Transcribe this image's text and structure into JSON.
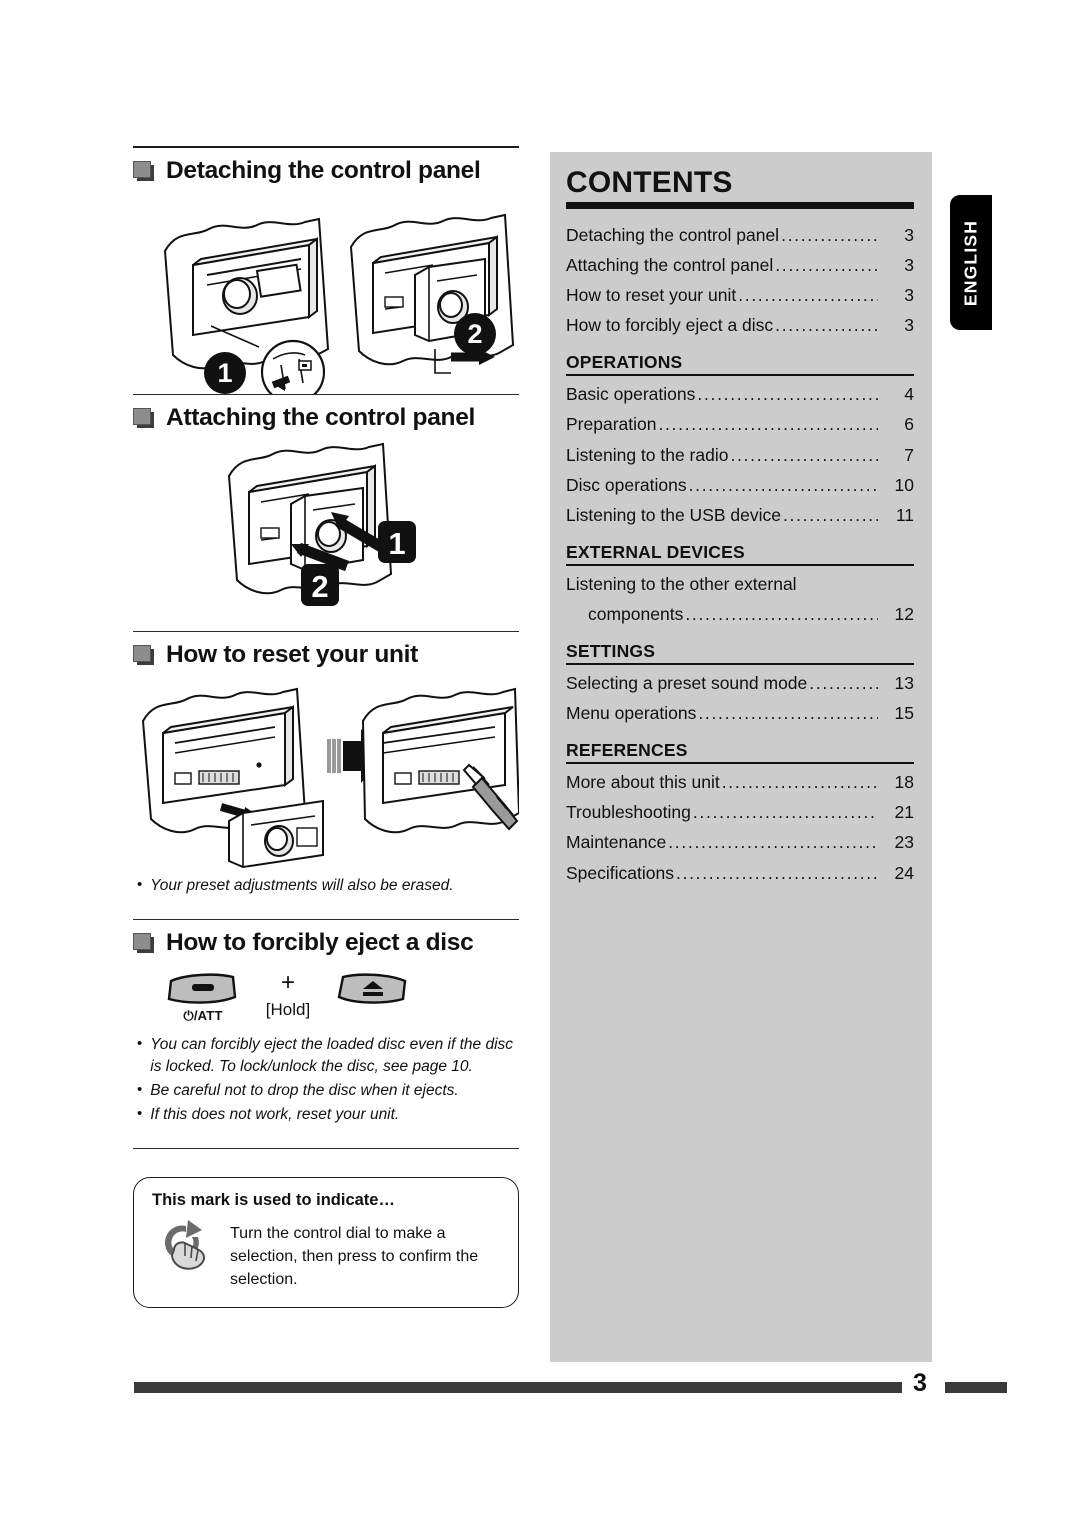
{
  "page": {
    "number": "3",
    "language_tab": "ENGLISH"
  },
  "left_column": {
    "sections": [
      {
        "id": "detaching",
        "title": "Detaching the control panel"
      },
      {
        "id": "attaching",
        "title": "Attaching the control panel"
      },
      {
        "id": "reset",
        "title": "How to reset your unit"
      },
      {
        "id": "eject",
        "title": "How to forcibly eject a disc"
      }
    ],
    "reset_notes": [
      {
        "bullet": "•",
        "text": "Your preset adjustments will also be erased."
      }
    ],
    "eject_buttons": {
      "power_label": "⏻/ATT",
      "plus": "+",
      "hold": "[Hold]",
      "eject_label": ""
    },
    "eject_notes": [
      {
        "bullet": "•",
        "text": "You can forcibly eject the loaded disc even if the disc is locked. To lock/unlock the disc, see page 10."
      },
      {
        "bullet": "•",
        "text": "Be careful not to drop the disc when it ejects."
      },
      {
        "bullet": "•",
        "text": "If this does not work, reset your unit."
      }
    ],
    "mark_box": {
      "title": "This mark is used to indicate…",
      "text": "Turn the control dial to make a selection, then press to confirm the selection.",
      "icon": "rotate-dial-hand-icon"
    },
    "figure_numbers": {
      "detaching": [
        "1",
        "2"
      ],
      "attaching": [
        "1",
        "2"
      ]
    }
  },
  "contents": {
    "title": "CONTENTS",
    "groups": [
      {
        "heading": "",
        "entries": [
          {
            "label": "Detaching the control panel",
            "page": "3"
          },
          {
            "label": "Attaching the control panel",
            "page": "3"
          },
          {
            "label": "How to reset your unit",
            "page": "3"
          },
          {
            "label": "How to forcibly eject a disc",
            "page": "3"
          }
        ]
      },
      {
        "heading": "OPERATIONS",
        "entries": [
          {
            "label": "Basic operations",
            "page": "4"
          },
          {
            "label": "Preparation",
            "page": "6"
          },
          {
            "label": "Listening to the radio",
            "page": "7"
          },
          {
            "label": "Disc operations",
            "page": "10"
          },
          {
            "label": "Listening to the USB device",
            "page": "11"
          }
        ]
      },
      {
        "heading": "EXTERNAL DEVICES",
        "entries": [
          {
            "label": "Listening to the other external",
            "page": "",
            "no_dots": true
          },
          {
            "label": "components",
            "page": "12",
            "indent": true
          }
        ]
      },
      {
        "heading": "SETTINGS",
        "entries": [
          {
            "label": "Selecting a preset sound mode",
            "page": "13"
          },
          {
            "label": "Menu operations",
            "page": "15"
          }
        ]
      },
      {
        "heading": "REFERENCES",
        "entries": [
          {
            "label": "More about this unit",
            "page": "18"
          },
          {
            "label": "Troubleshooting",
            "page": "21"
          },
          {
            "label": "Maintenance",
            "page": "23"
          },
          {
            "label": "Specifications",
            "page": "24"
          }
        ]
      }
    ],
    "leader": "................................................................"
  },
  "colors": {
    "panel_bg": "#cccccc",
    "ink": "#111111",
    "bar": "#3a3a3a",
    "marker_grey": "#8d8d8d"
  }
}
